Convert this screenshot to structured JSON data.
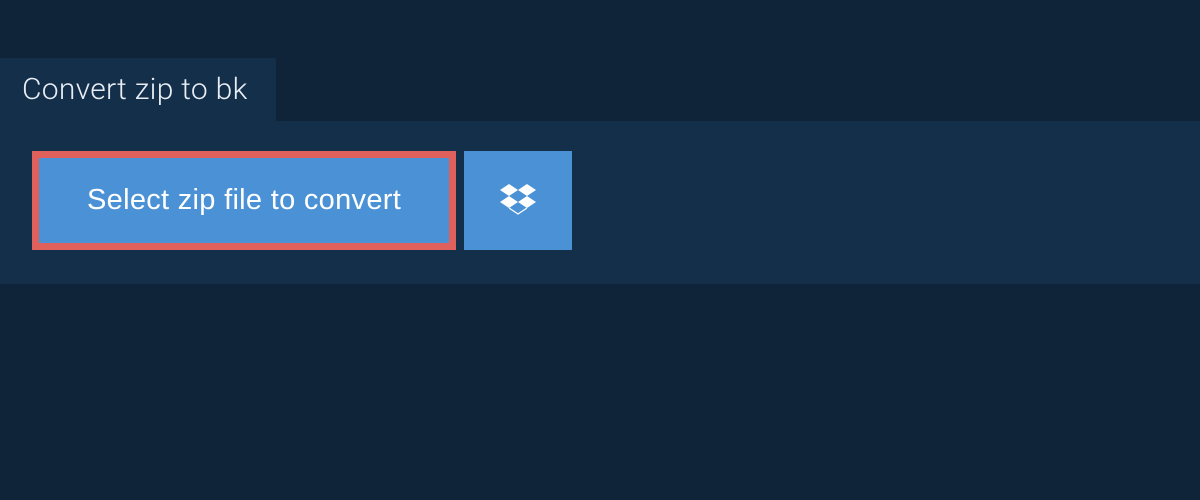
{
  "tab": {
    "title": "Convert zip to bk"
  },
  "actions": {
    "select_file_label": "Select zip file to convert"
  },
  "colors": {
    "page_bg": "#0f2438",
    "panel_bg": "#132f4a",
    "button_bg": "#4b91d5",
    "highlight_border": "#e0615b",
    "text_light": "#e8eef4"
  }
}
